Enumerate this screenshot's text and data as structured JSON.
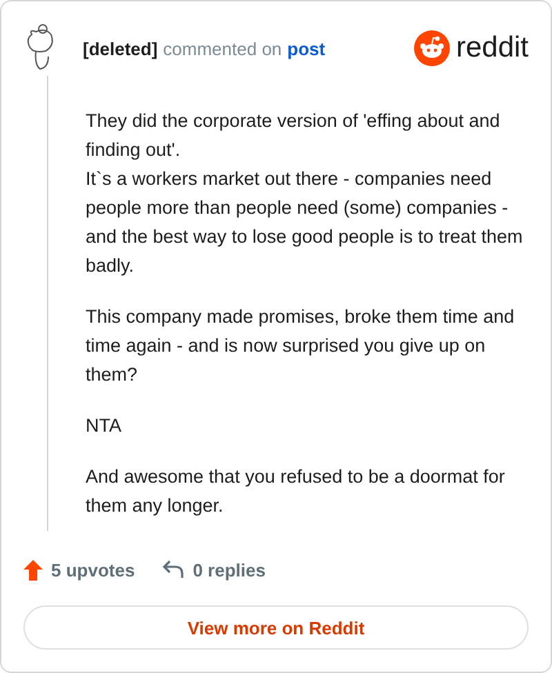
{
  "header": {
    "author": "[deleted]",
    "action": "commented on",
    "target": "post",
    "brand": "reddit"
  },
  "paragraphs": [
    "They did the corporate version of 'effing about and finding out'.\nIt`s a workers market out there - companies need people more than people need (some) companies - and the best way to lose good people is to treat them badly.",
    "This company made promises, broke them time and time again - and is now surprised you give up on them?",
    "NTA",
    "And awesome that you refused to be a doormat for them any longer."
  ],
  "footer": {
    "upvotes": "5 upvotes",
    "replies": "0 replies"
  },
  "button": "View more on Reddit"
}
